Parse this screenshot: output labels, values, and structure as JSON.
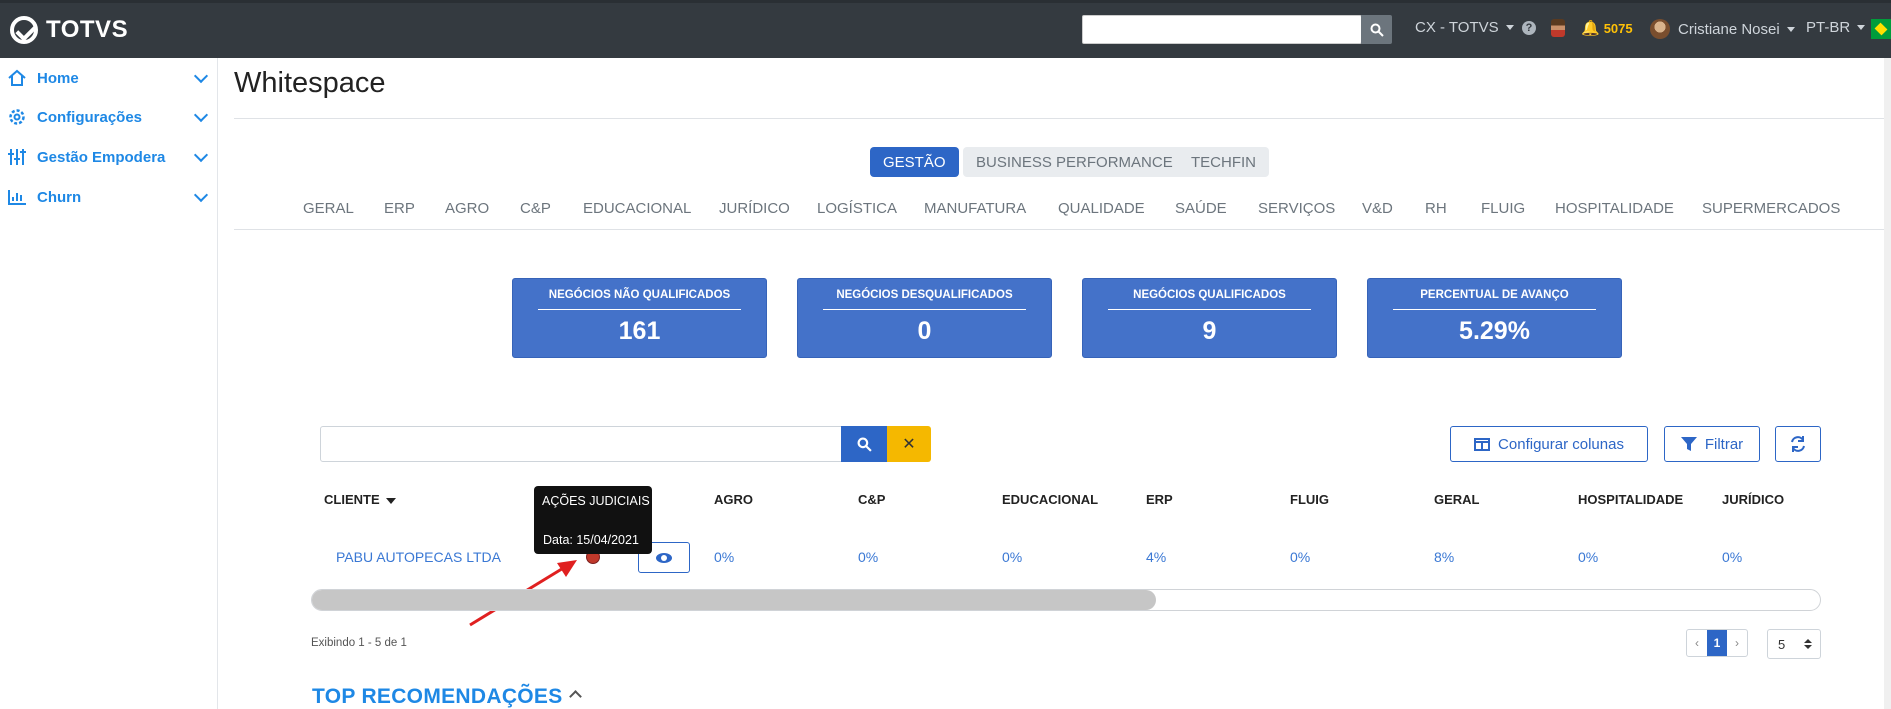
{
  "app": {
    "brand": "TOTVS",
    "icons": {
      "logo": "totvs-logo-icon",
      "search": "search-icon",
      "help": "help-icon",
      "bell": "bell-icon",
      "flag": "brazil-flag-icon"
    },
    "colors": {
      "topbar": "#343a40",
      "primary": "#2d66c6",
      "accent": "#1e88e5",
      "warning": "#f5b800",
      "card": "#4472c9"
    }
  },
  "topbar": {
    "search_placeholder": "",
    "org": "CX - TOTVS",
    "help": "?",
    "notifications": "5075",
    "user": "Cristiane Nosei",
    "language": "PT-BR"
  },
  "sidebar": {
    "items": [
      {
        "label": "Home",
        "icon": "home-icon"
      },
      {
        "label": "Configurações",
        "icon": "gear-icon"
      },
      {
        "label": "Gestão Empodera",
        "icon": "sliders-icon"
      },
      {
        "label": "Churn",
        "icon": "bar-chart-icon"
      }
    ]
  },
  "page": {
    "title": "Whitespace"
  },
  "tabs": [
    "GESTÃO",
    "BUSINESS PERFORMANCE",
    "TECHFIN"
  ],
  "categories": [
    "GERAL",
    "ERP",
    "AGRO",
    "C&P",
    "EDUCACIONAL",
    "JURÍDICO",
    "LOGÍSTICA",
    "MANUFATURA",
    "QUALIDADE",
    "SAÚDE",
    "SERVIÇOS",
    "V&D",
    "RH",
    "FLUIG",
    "HOSPITALIDADE",
    "SUPERMERCADOS"
  ],
  "cards": [
    {
      "label": "NEGÓCIOS NÃO QUALIFICADOS",
      "value": "161"
    },
    {
      "label": "NEGÓCIOS DESQUALIFICADOS",
      "value": "0"
    },
    {
      "label": "NEGÓCIOS QUALIFICADOS",
      "value": "9"
    },
    {
      "label": "PERCENTUAL DE AVANÇO",
      "value": "5.29%"
    }
  ],
  "table_controls": {
    "search_value": "",
    "clear": "✕",
    "configure_columns": "Configurar colunas",
    "filter": "Filtrar"
  },
  "table": {
    "headers": [
      "CLIENTE",
      "AGRO",
      "C&P",
      "EDUCACIONAL",
      "ERP",
      "FLUIG",
      "GERAL",
      "HOSPITALIDADE",
      "JURÍDICO"
    ],
    "rows": [
      {
        "cliente": "PABU AUTOPECAS LTDA",
        "values": [
          "0%",
          "0%",
          "0%",
          "4%",
          "0%",
          "8%",
          "0%",
          "0%"
        ]
      }
    ],
    "scroll_fraction": 0.56
  },
  "tooltip": {
    "title": "AÇÕES JUDICIAIS",
    "date": "Data: 15/04/2021"
  },
  "pagination": {
    "showing": "Exibindo 1 - 5 de 1",
    "prev": "‹",
    "current": "1",
    "next": "›",
    "page_size": "5"
  },
  "section": {
    "title": "TOP RECOMENDAÇÕES"
  }
}
